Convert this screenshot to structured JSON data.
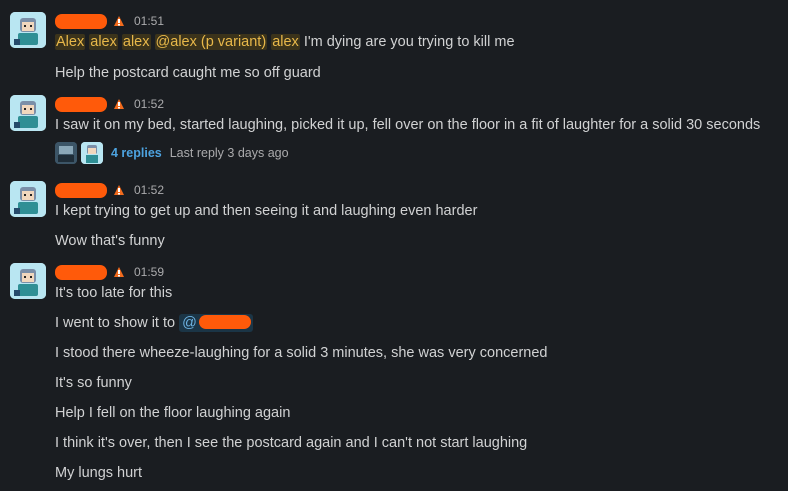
{
  "messages": [
    {
      "time": "01:51",
      "lines": [
        {
          "segments": [
            "Alex",
            "alex",
            "alex",
            "@alex (p variant)",
            "alex"
          ],
          "rest": "I'm dying are you trying to kill me"
        },
        {
          "text": "Help the postcard caught me so off guard"
        }
      ]
    },
    {
      "time": "01:52",
      "lines": [
        {
          "text": "I saw it on my bed, started laughing, picked it up, fell over on the floor in a fit of laughter for a solid 30 seconds"
        }
      ],
      "thread": {
        "replies": "4 replies",
        "last_reply": "Last reply 3 days ago"
      }
    },
    {
      "time": "01:52",
      "lines": [
        {
          "text": "I kept trying to get up and then seeing it and laughing even harder"
        },
        {
          "text": "Wow that's funny"
        }
      ]
    },
    {
      "time": "01:59",
      "lines": [
        {
          "text": "It's too late for this"
        },
        {
          "text": "I went to show it to",
          "mention_prefix": "@"
        },
        {
          "text": "I stood there wheeze-laughing for a solid 3 minutes, she was very concerned"
        },
        {
          "text": "It's so funny"
        },
        {
          "text": "Help I fell on the floor laughing again"
        },
        {
          "text": "I think it's over, then I see the postcard again and I can't not start laughing"
        },
        {
          "text": "My lungs hurt"
        }
      ]
    }
  ],
  "colors": {
    "background": "#1a1d21",
    "text": "#d1d2d3",
    "timestamp": "#ababad",
    "link": "#4da3e0",
    "highlight_text": "#e8b84a",
    "highlight_bg": "#3b331b",
    "redaction": "#ff5a0a"
  },
  "icons": {
    "status_badge": "warning-cone-icon",
    "avatar": "user-avatar"
  }
}
